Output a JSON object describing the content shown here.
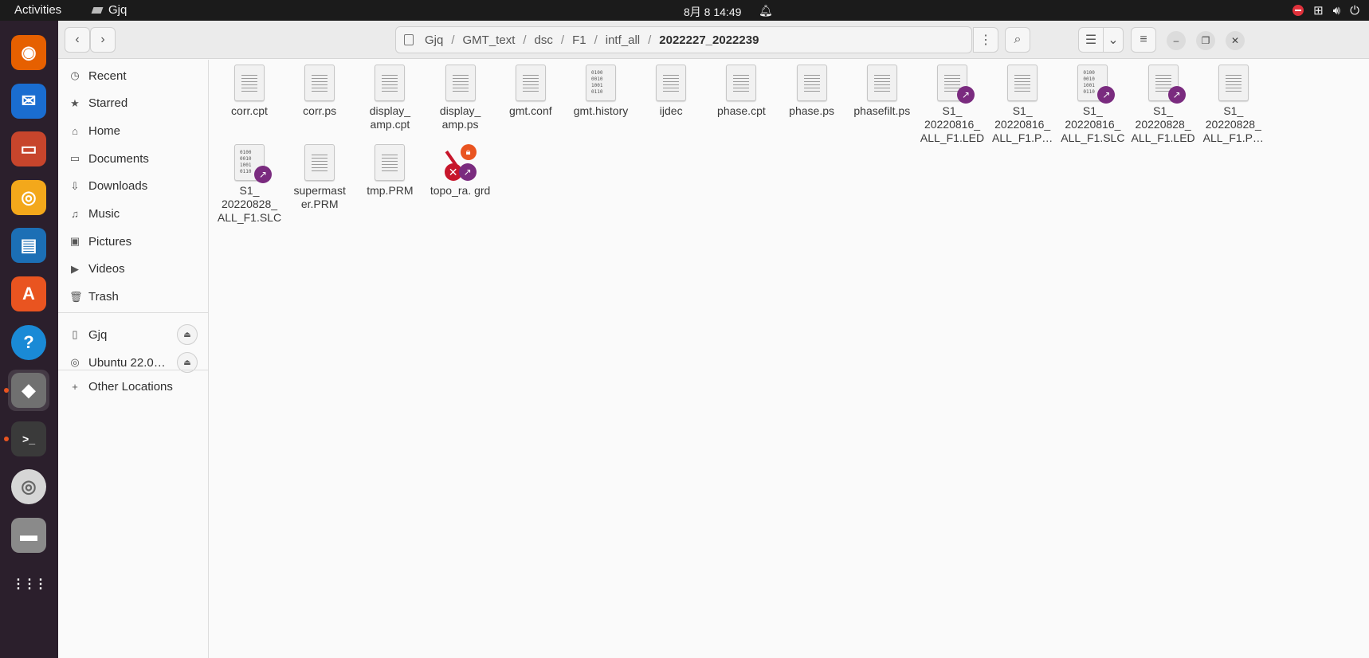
{
  "topbar": {
    "activities": "Activities",
    "app_name": "Gjq",
    "clock": "8月 8  14:49"
  },
  "dock": {
    "items": [
      {
        "name": "firefox",
        "color": "#e66000"
      },
      {
        "name": "thunderbird",
        "color": "#1a6dd0"
      },
      {
        "name": "files",
        "color": "#c7452c"
      },
      {
        "name": "rhythmbox",
        "color": "#f3a81b"
      },
      {
        "name": "libreoffice-writer",
        "color": "#1c6fb5"
      },
      {
        "name": "app-center",
        "color": "#e95420"
      },
      {
        "name": "help",
        "color": "#1a8ad6"
      },
      {
        "name": "drive",
        "color": "#707070"
      },
      {
        "name": "terminal",
        "color": "#3a3a3a"
      },
      {
        "name": "cd-drive",
        "color": "#d6d6d6"
      },
      {
        "name": "removable-drive",
        "color": "#8a8a8a"
      },
      {
        "name": "show-apps",
        "color": "#ffffff"
      }
    ]
  },
  "path": {
    "segments": [
      "Gjq",
      "GMT_text",
      "dsc",
      "F1",
      "intf_all"
    ],
    "current": "2022227_2022239"
  },
  "sidebar": {
    "places": [
      "Recent",
      "Starred",
      "Home",
      "Documents",
      "Downloads",
      "Music",
      "Pictures",
      "Videos",
      "Trash"
    ],
    "devices": [
      "Gjq",
      "Ubuntu 22.0…"
    ],
    "other": "Other Locations"
  },
  "files": [
    {
      "name": "corr.cpt",
      "type": "text"
    },
    {
      "name": "corr.ps",
      "type": "text"
    },
    {
      "name": "display_ amp.cpt",
      "type": "text"
    },
    {
      "name": "display_ amp.ps",
      "type": "text"
    },
    {
      "name": "gmt.conf",
      "type": "text"
    },
    {
      "name": "gmt.history",
      "type": "binary"
    },
    {
      "name": "ijdec",
      "type": "text"
    },
    {
      "name": "phase.cpt",
      "type": "text"
    },
    {
      "name": "phase.ps",
      "type": "text"
    },
    {
      "name": "phasefilt.ps",
      "type": "text"
    },
    {
      "name": "S1_ 20220816_ ALL_F1.LED",
      "type": "text-link"
    },
    {
      "name": "S1_ 20220816_ ALL_F1.P…",
      "type": "text"
    },
    {
      "name": "S1_ 20220816_ ALL_F1.SLC",
      "type": "binary-link"
    },
    {
      "name": "S1_ 20220828_ ALL_F1.LED",
      "type": "text-link"
    },
    {
      "name": "S1_ 20220828_ ALL_F1.P…",
      "type": "text"
    },
    {
      "name": "S1_ 20220828_ ALL_F1.SLC",
      "type": "binary-link"
    },
    {
      "name": "supermast er.PRM",
      "type": "text"
    },
    {
      "name": "tmp.PRM",
      "type": "text"
    },
    {
      "name": "topo_ra. grd",
      "type": "broken-link"
    }
  ]
}
